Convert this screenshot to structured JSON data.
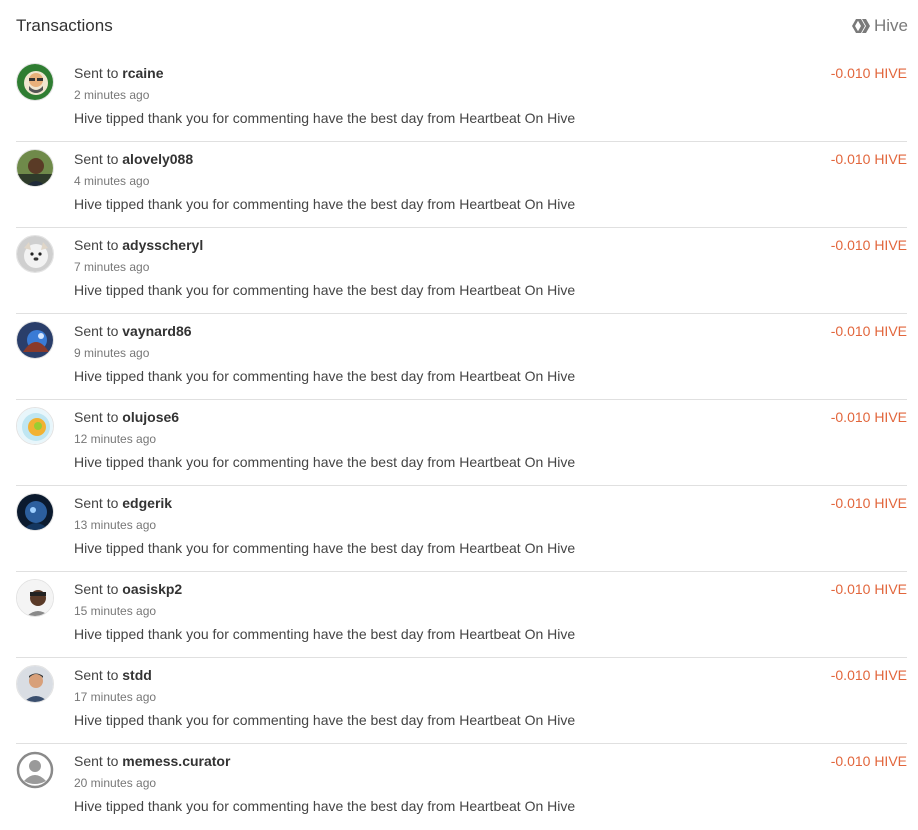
{
  "header": {
    "title": "Transactions",
    "token_label": "Hive",
    "token_icon": "hive-logo-icon"
  },
  "colors": {
    "amount": "#e2663c",
    "divider": "#e0e0e0"
  },
  "transactions": [
    {
      "prefix": "Sent to ",
      "recipient": "rcaine",
      "time": "2 minutes ago",
      "memo": "Hive tipped thank you for commenting have the best day from Heartbeat On Hive",
      "amount": "-0.010 HIVE",
      "avatar_icon": "avatar-image"
    },
    {
      "prefix": "Sent to ",
      "recipient": "alovely088",
      "time": "4 minutes ago",
      "memo": "Hive tipped thank you for commenting have the best day from Heartbeat On Hive",
      "amount": "-0.010 HIVE",
      "avatar_icon": "avatar-image"
    },
    {
      "prefix": "Sent to ",
      "recipient": "adysscheryl",
      "time": "7 minutes ago",
      "memo": "Hive tipped thank you for commenting have the best day from Heartbeat On Hive",
      "amount": "-0.010 HIVE",
      "avatar_icon": "avatar-image"
    },
    {
      "prefix": "Sent to ",
      "recipient": "vaynard86",
      "time": "9 minutes ago",
      "memo": "Hive tipped thank you for commenting have the best day from Heartbeat On Hive",
      "amount": "-0.010 HIVE",
      "avatar_icon": "avatar-image"
    },
    {
      "prefix": "Sent to ",
      "recipient": "olujose6",
      "time": "12 minutes ago",
      "memo": "Hive tipped thank you for commenting have the best day from Heartbeat On Hive",
      "amount": "-0.010 HIVE",
      "avatar_icon": "avatar-image"
    },
    {
      "prefix": "Sent to ",
      "recipient": "edgerik",
      "time": "13 minutes ago",
      "memo": "Hive tipped thank you for commenting have the best day from Heartbeat On Hive",
      "amount": "-0.010 HIVE",
      "avatar_icon": "avatar-image"
    },
    {
      "prefix": "Sent to ",
      "recipient": "oasiskp2",
      "time": "15 minutes ago",
      "memo": "Hive tipped thank you for commenting have the best day from Heartbeat On Hive",
      "amount": "-0.010 HIVE",
      "avatar_icon": "avatar-image"
    },
    {
      "prefix": "Sent to ",
      "recipient": "stdd",
      "time": "17 minutes ago",
      "memo": "Hive tipped thank you for commenting have the best day from Heartbeat On Hive",
      "amount": "-0.010 HIVE",
      "avatar_icon": "avatar-image"
    },
    {
      "prefix": "Sent to ",
      "recipient": "memess.curator",
      "time": "20 minutes ago",
      "memo": "Hive tipped thank you for commenting have the best day from Heartbeat On Hive",
      "amount": "-0.010 HIVE",
      "avatar_icon": "default-user-icon"
    }
  ]
}
